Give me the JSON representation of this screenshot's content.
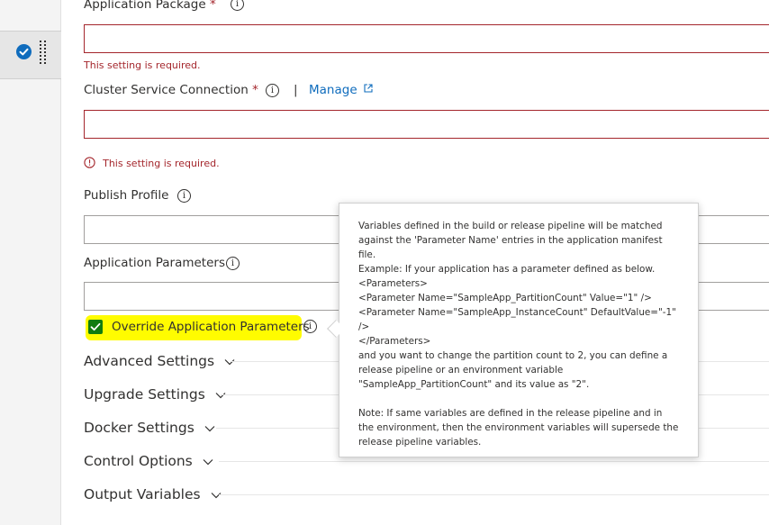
{
  "fields": {
    "application_package": {
      "label": "Application Package",
      "required_mark": "*",
      "error": "This setting is required.",
      "value": ""
    },
    "cluster_connection": {
      "label": "Cluster Service Connection",
      "required_mark": "*",
      "separator": "|",
      "manage_label": "Manage",
      "error": "This setting is required.",
      "value": ""
    },
    "publish_profile": {
      "label": "Publish Profile",
      "value": ""
    },
    "application_parameters": {
      "label": "Application Parameters",
      "value": ""
    }
  },
  "override_checkbox": {
    "label": "Override Application Parameters",
    "checked": true
  },
  "sections": [
    {
      "title": "Advanced Settings"
    },
    {
      "title": "Upgrade Settings"
    },
    {
      "title": "Docker Settings"
    },
    {
      "title": "Control Options"
    },
    {
      "title": "Output Variables"
    }
  ],
  "tooltip": {
    "line1": "Variables defined in the build or release pipeline will be matched against the 'Parameter Name' entries in the application manifest file.",
    "line2": "Example: If your application has a parameter defined as below.",
    "line3": "<Parameters>",
    "line4": "<Parameter Name=\"SampleApp_PartitionCount\" Value=\"1\" />",
    "line5": "<Parameter Name=\"SampleApp_InstanceCount\" DefaultValue=\"-1\" />",
    "line6": "</Parameters>",
    "line7": "and you want to change the partition count to 2, you can define a release pipeline or an environment variable \"SampleApp_PartitionCount\" and its value as \"2\".",
    "note": "Note: If same variables are defined in the release pipeline and in the environment, then the environment variables will supersede the release pipeline variables."
  },
  "colors": {
    "error": "#a4262c",
    "link": "#0f6cbd",
    "checkbox": "#107c10",
    "highlight": "#fffc00"
  },
  "icons": {
    "info": "i",
    "external_link": "external-link-icon",
    "chevron": "chevron-down-icon"
  }
}
